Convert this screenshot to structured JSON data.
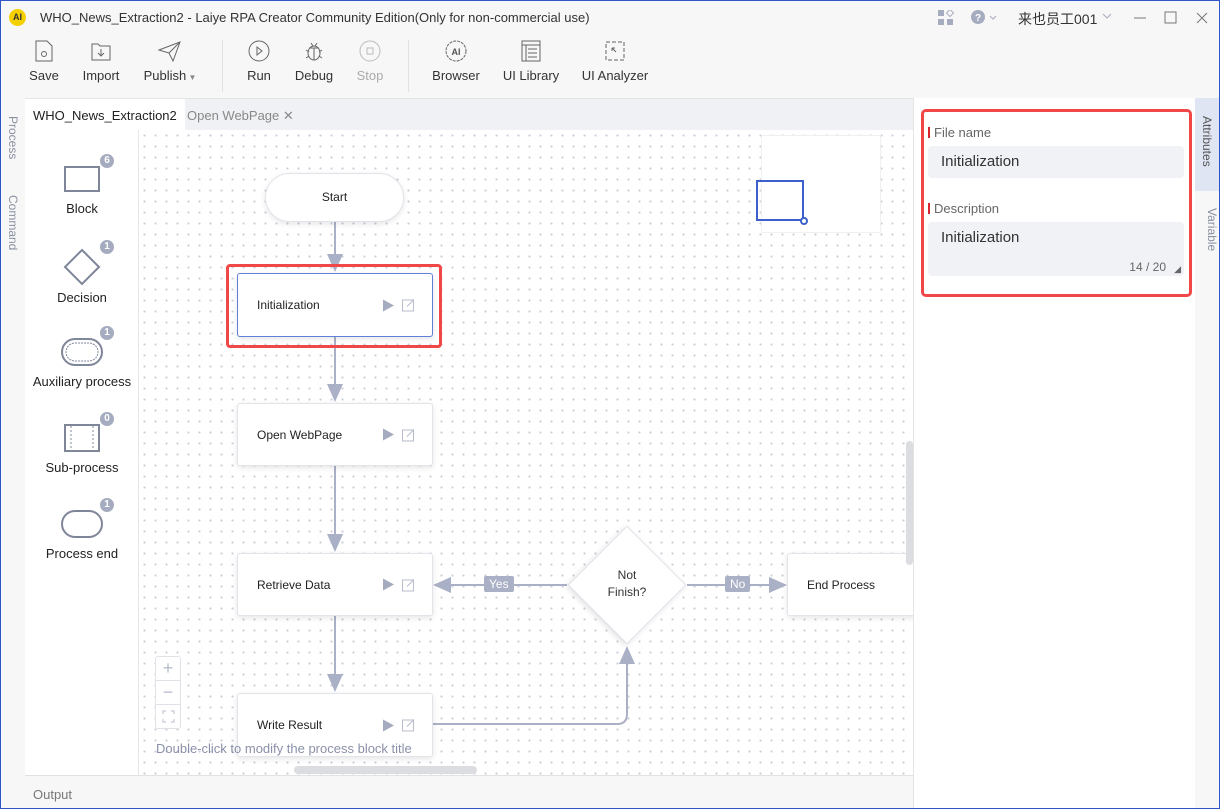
{
  "window": {
    "title": "WHO_News_Extraction2 - Laiye RPA Creator Community Edition(Only for non-commercial use)",
    "user": "来也员工001",
    "logo_text": "AI"
  },
  "toolbar": [
    {
      "label": "Save",
      "icon": "save-icon"
    },
    {
      "label": "Import",
      "icon": "import-icon"
    },
    {
      "label": "Publish",
      "icon": "paper-plane-icon"
    },
    {
      "label": "Run",
      "icon": "play-circle-icon"
    },
    {
      "label": "Debug",
      "icon": "bug-icon"
    },
    {
      "label": "Stop",
      "icon": "stop-circle-icon",
      "disabled": true
    },
    {
      "label": "Browser",
      "icon": "ai-browser-icon"
    },
    {
      "label": "UI Library",
      "icon": "ui-library-icon"
    },
    {
      "label": "UI Analyzer",
      "icon": "ui-analyzer-icon"
    }
  ],
  "tabs": [
    {
      "label": "WHO_News_Extraction2",
      "active": true
    },
    {
      "label": "Open WebPage",
      "active": false
    }
  ],
  "left_vtabs": [
    "Process",
    "Command"
  ],
  "right_vtabs": [
    "Attributes",
    "Variable"
  ],
  "palette": [
    {
      "label": "Block",
      "count": "6"
    },
    {
      "label": "Decision",
      "count": "1"
    },
    {
      "label": "Auxiliary process",
      "count": "1"
    },
    {
      "label": "Sub-process",
      "count": "0"
    },
    {
      "label": "Process end",
      "count": "1"
    }
  ],
  "flow": {
    "start": "Start",
    "nodes": [
      "Initialization",
      "Open WebPage",
      "Retrieve Data",
      "Write Result"
    ],
    "decision": "Not\nFinish?",
    "end": "End Process",
    "edge_yes": "Yes",
    "edge_no": "No",
    "selected": "Initialization"
  },
  "canvas": {
    "hint": "Double-click to modify the process block title"
  },
  "output": {
    "label": "Output"
  },
  "attributes": {
    "file_name_label": "File name",
    "file_name_value": "Initialization",
    "description_label": "Description",
    "description_value": "Initialization",
    "char_count": "14 / 20"
  },
  "colors": {
    "accent": "#3d5fc8",
    "highlight": "#f04848",
    "edge": "#aab0c6"
  }
}
